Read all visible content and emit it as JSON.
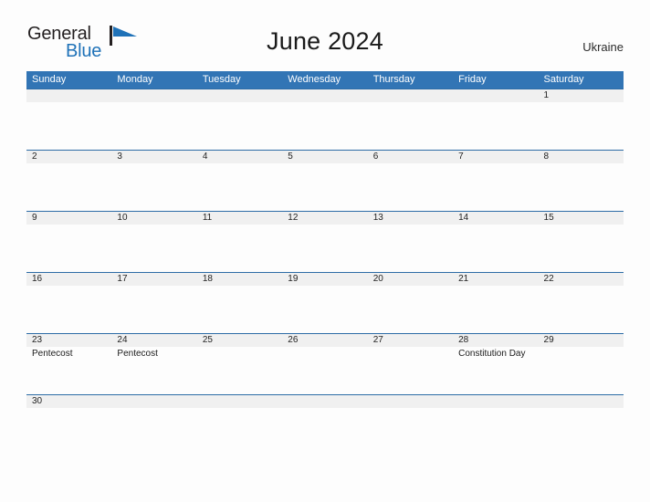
{
  "brand": {
    "name_part1": "General",
    "name_part2": "Blue",
    "flag_icon": "blue-triangle-flag-icon",
    "color_dark": "#231f20",
    "color_blue": "#1f72b8"
  },
  "header": {
    "title": "June 2024",
    "country": "Ukraine"
  },
  "colors": {
    "header_blue": "#3275b5",
    "row_divider_blue": "#2d6ca6",
    "number_band_gray": "#f0f0f0",
    "page_background": "#fdfdfd"
  },
  "calendar": {
    "day_headers": [
      "Sunday",
      "Monday",
      "Tuesday",
      "Wednesday",
      "Thursday",
      "Friday",
      "Saturday"
    ],
    "weeks": [
      {
        "days": [
          {
            "date": "",
            "events": []
          },
          {
            "date": "",
            "events": []
          },
          {
            "date": "",
            "events": []
          },
          {
            "date": "",
            "events": []
          },
          {
            "date": "",
            "events": []
          },
          {
            "date": "",
            "events": []
          },
          {
            "date": "1",
            "events": []
          }
        ]
      },
      {
        "days": [
          {
            "date": "2",
            "events": []
          },
          {
            "date": "3",
            "events": []
          },
          {
            "date": "4",
            "events": []
          },
          {
            "date": "5",
            "events": []
          },
          {
            "date": "6",
            "events": []
          },
          {
            "date": "7",
            "events": []
          },
          {
            "date": "8",
            "events": []
          }
        ]
      },
      {
        "days": [
          {
            "date": "9",
            "events": []
          },
          {
            "date": "10",
            "events": []
          },
          {
            "date": "11",
            "events": []
          },
          {
            "date": "12",
            "events": []
          },
          {
            "date": "13",
            "events": []
          },
          {
            "date": "14",
            "events": []
          },
          {
            "date": "15",
            "events": []
          }
        ]
      },
      {
        "days": [
          {
            "date": "16",
            "events": []
          },
          {
            "date": "17",
            "events": []
          },
          {
            "date": "18",
            "events": []
          },
          {
            "date": "19",
            "events": []
          },
          {
            "date": "20",
            "events": []
          },
          {
            "date": "21",
            "events": []
          },
          {
            "date": "22",
            "events": []
          }
        ]
      },
      {
        "days": [
          {
            "date": "23",
            "events": [
              "Pentecost"
            ]
          },
          {
            "date": "24",
            "events": [
              "Pentecost"
            ]
          },
          {
            "date": "25",
            "events": []
          },
          {
            "date": "26",
            "events": []
          },
          {
            "date": "27",
            "events": []
          },
          {
            "date": "28",
            "events": [
              "Constitution Day"
            ]
          },
          {
            "date": "29",
            "events": []
          }
        ]
      },
      {
        "short": true,
        "days": [
          {
            "date": "30",
            "events": []
          },
          {
            "date": "",
            "events": []
          },
          {
            "date": "",
            "events": []
          },
          {
            "date": "",
            "events": []
          },
          {
            "date": "",
            "events": []
          },
          {
            "date": "",
            "events": []
          },
          {
            "date": "",
            "events": []
          }
        ]
      }
    ]
  }
}
